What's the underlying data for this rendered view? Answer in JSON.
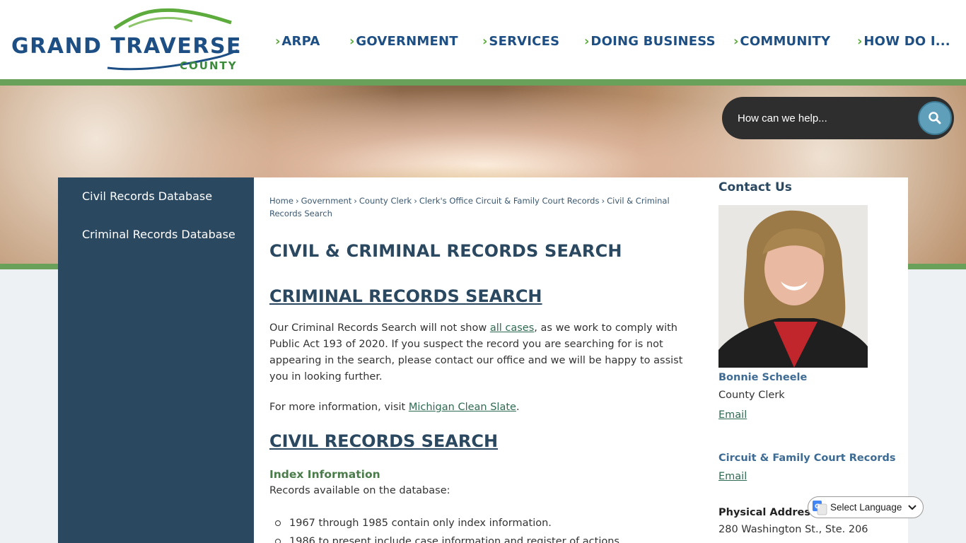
{
  "header": {
    "logo": {
      "name": "GRAND TRAVERSE",
      "sub": "COUNTY"
    },
    "nav": [
      {
        "label": "ARPA"
      },
      {
        "label": "GOVERNMENT"
      },
      {
        "label": "SERVICES"
      },
      {
        "label": "DOING BUSINESS"
      },
      {
        "label": "COMMUNITY"
      },
      {
        "label": "HOW DO I..."
      }
    ]
  },
  "search": {
    "placeholder": "How can we help...",
    "icon": "search-icon"
  },
  "sidebar": {
    "items": [
      {
        "label": "Civil Records Database"
      },
      {
        "label": "Criminal Records Database"
      }
    ]
  },
  "breadcrumb": [
    {
      "label": "Home"
    },
    {
      "label": "Government"
    },
    {
      "label": "County Clerk"
    },
    {
      "label": "Clerk's Office Circuit & Family Court Records"
    },
    {
      "label": "Civil & Criminal Records Search"
    }
  ],
  "main": {
    "title": "CIVIL & CRIMINAL RECORDS SEARCH",
    "criminal_heading": "CRIMINAL RECORDS SEARCH",
    "criminal_p1_a": "Our Criminal Records Search will not show ",
    "criminal_p1_link": "all cases",
    "criminal_p1_b": ", as we work to comply with Public Act 193 of 2020. If you suspect the record you are searching for is not appearing in the search, please contact our office and we will be happy to assist you in looking further.",
    "criminal_p2_a": "For more information, visit ",
    "criminal_p2_link": "Michigan Clean Slate",
    "criminal_p2_b": ".",
    "civil_heading": "CIVIL RECORDS SEARCH",
    "index_heading": "Index Information",
    "index_intro": "Records available on the database:",
    "index_items": [
      "1967 through 1985 contain only index information.",
      "1986 to present include case information and register of actions."
    ]
  },
  "contact": {
    "title": "Contact Us",
    "name": "Bonnie Scheele",
    "role": "County Clerk",
    "email_label": "Email",
    "dept": "Circuit & Family Court Records",
    "dept_email_label": "Email",
    "address_label": "Physical Address",
    "address_line": "280 Washington St., Ste. 206"
  },
  "translate": {
    "label": "Select Language"
  },
  "colors": {
    "brand_blue": "#1d4f84",
    "brand_green": "#6aa15a",
    "sidebar_bg": "#2b4861",
    "search_bg": "#2e2e2e",
    "search_btn": "#5f9fba"
  }
}
